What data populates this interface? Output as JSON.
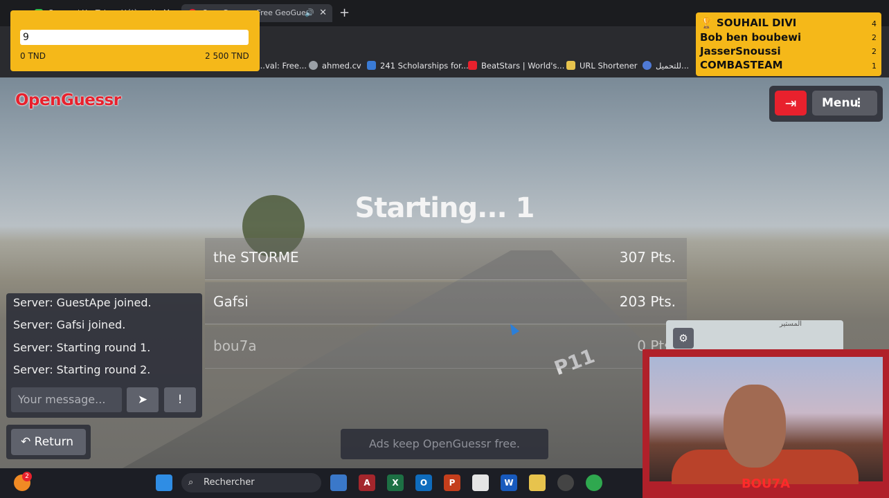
{
  "browser": {
    "tabs": [
      {
        "title": "Soraya | YouTube - Hélène Ho..."
      },
      {
        "title": "OpenGuessr - Free GeoGues"
      }
    ],
    "new_tab_icon": "plus-icon",
    "bookmarks": [
      {
        "label": "...val: Free...",
        "icon": "bookmark-icon"
      },
      {
        "label": "ahmed.cv",
        "icon": "globe-icon"
      },
      {
        "label": "241 Scholarships for...",
        "icon": "scholarship-icon"
      },
      {
        "label": "BeatStars | World's...",
        "icon": "beatstars-icon"
      },
      {
        "label": "URL Shortener",
        "icon": "folder-icon"
      },
      {
        "label": "للتحميل...",
        "icon": "gear-icon"
      }
    ]
  },
  "game": {
    "logo": "OpenGuessr",
    "menu_label": "Menu",
    "exit_icon": "exit-icon",
    "status": "Starting... 1",
    "leaderboard": [
      {
        "name": "the STORME",
        "points": "307 Pts."
      },
      {
        "name": "Gafsi",
        "points": "203 Pts."
      },
      {
        "name": "bou7a",
        "points": "0 Pts."
      }
    ],
    "chat": {
      "messages": [
        "Server: GuestApe joined.",
        "Server: Gafsi joined.",
        "Server: Starting round 1.",
        "Server: Starting round 2."
      ],
      "input_placeholder": "Your message...",
      "send_icon": "send-icon",
      "report_icon": "report-icon"
    },
    "return_label": "Return",
    "ads_text": "Ads keep OpenGuessr free.",
    "map_label": "المستير",
    "road_marking": "P11"
  },
  "overlays": {
    "donation_goal": {
      "value": "9",
      "min": "0 TND",
      "max": "2 500 TND"
    },
    "top_donors": [
      {
        "name": "SOUHAIL DIVI",
        "count": "4",
        "icon": "trophy-icon"
      },
      {
        "name": "Bob ben boubewi",
        "count": "2"
      },
      {
        "name": "JasserSnoussi",
        "count": "2"
      },
      {
        "name": "COMBASTEAM",
        "count": "1"
      }
    ],
    "webcam_label": "BOU7A"
  },
  "taskbar": {
    "search_label": "Rechercher",
    "notification_count": "2"
  },
  "colors": {
    "brand_red": "#e8212d",
    "overlay_yellow": "#f5b819"
  }
}
